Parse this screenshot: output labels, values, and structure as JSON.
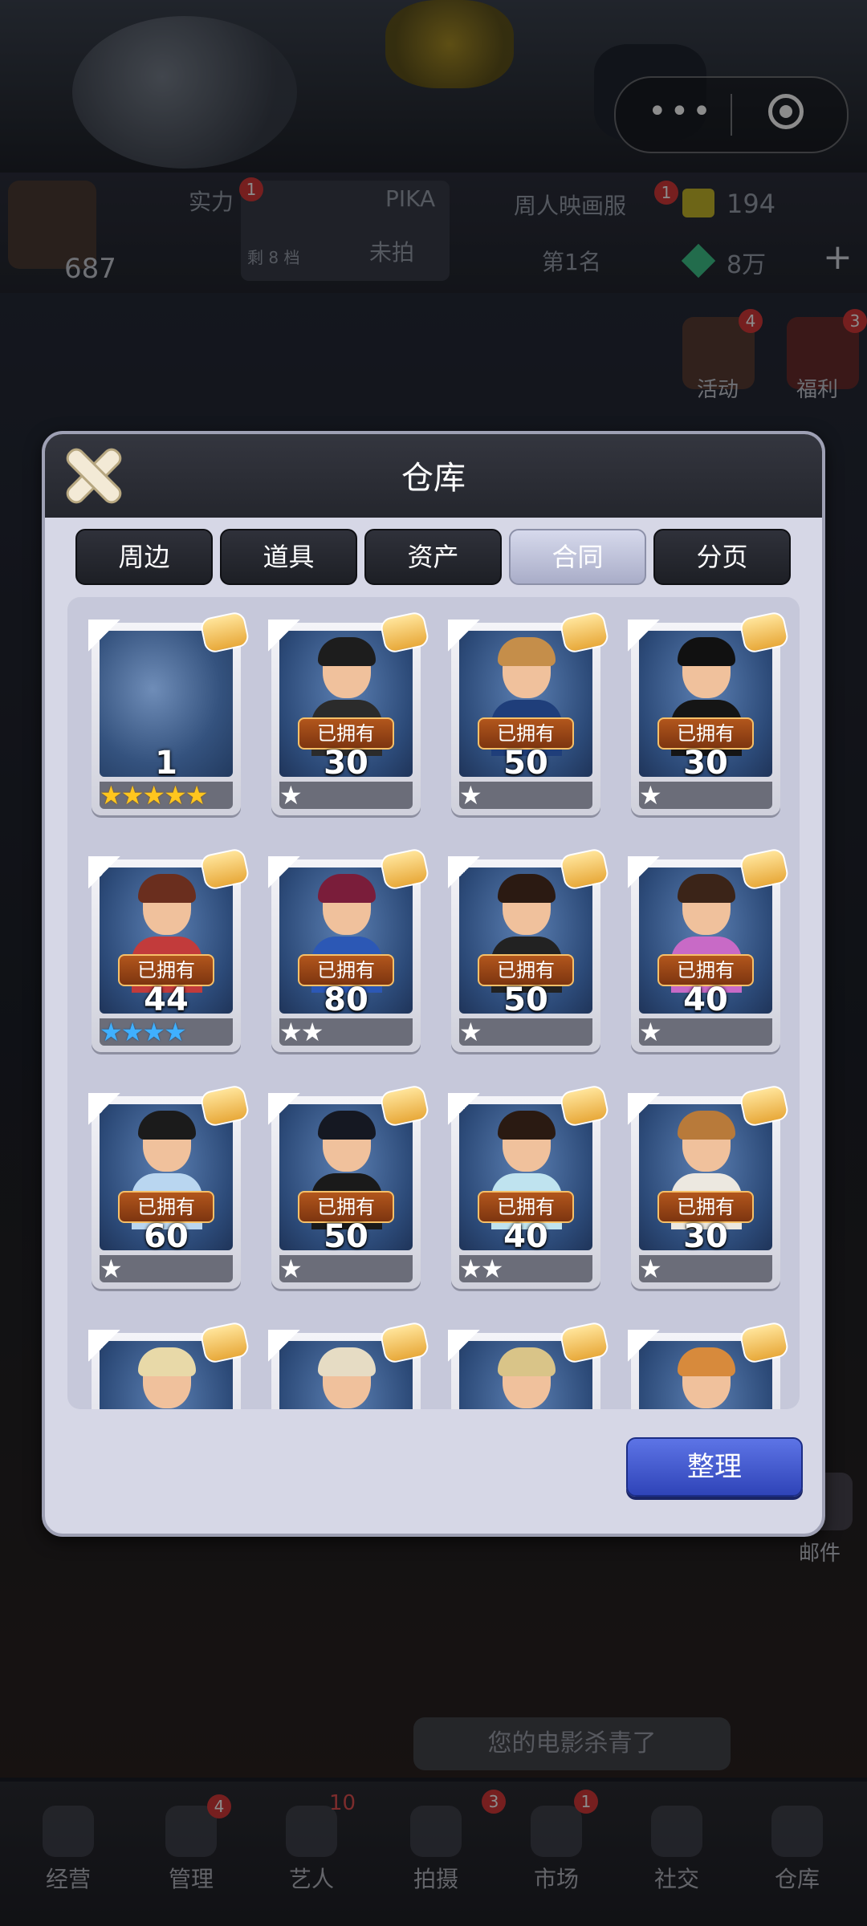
{
  "window": {
    "capsule": {
      "more_glyph": "•••",
      "close_glyph": "◎"
    }
  },
  "hud": {
    "player_score": "687",
    "strength_label": "实力",
    "film_title": "PIKA",
    "film_status": "未拍",
    "film_remaining": "剩 8 档",
    "ranking_title": "周人映画服",
    "ranking_value": "第1名",
    "coins": "194",
    "gems": "8万",
    "add_glyph": "+",
    "badges": {
      "film": "1",
      "ranking": "1",
      "player": "1"
    }
  },
  "side_menu": {
    "items": [
      {
        "label": "活动",
        "badge": "4"
      },
      {
        "label": "福利",
        "badge": "3"
      },
      {
        "label": "邮件",
        "badge": ""
      }
    ]
  },
  "background_message": "您的电影杀青了",
  "bottom_nav": {
    "items": [
      {
        "label": "经营",
        "badge": ""
      },
      {
        "label": "管理",
        "badge": "4"
      },
      {
        "label": "艺人",
        "badge": "10"
      },
      {
        "label": "拍摄",
        "badge": "3"
      },
      {
        "label": "市场",
        "badge": "1"
      },
      {
        "label": "社交",
        "badge": ""
      },
      {
        "label": "仓库",
        "badge": ""
      }
    ]
  },
  "modal": {
    "title": "仓库",
    "tabs": [
      {
        "label": "周边",
        "active": false
      },
      {
        "label": "道具",
        "active": false
      },
      {
        "label": "资产",
        "active": false
      },
      {
        "label": "合同",
        "active": true
      },
      {
        "label": "分页",
        "active": false
      }
    ],
    "owned_label": "已拥有",
    "cards": [
      {
        "count": "1",
        "owned": false,
        "stars": 5,
        "star_color": "gold",
        "hair": "#2a2a2a",
        "body": "#2d3b55",
        "blank": true
      },
      {
        "count": "30",
        "owned": true,
        "stars": 1,
        "star_color": "white",
        "hair": "#1d1d1d",
        "body": "#2b2b2b",
        "blank": false
      },
      {
        "count": "50",
        "owned": true,
        "stars": 1,
        "star_color": "white",
        "hair": "#c58e4a",
        "body": "#1f3e7a",
        "blank": false
      },
      {
        "count": "30",
        "owned": true,
        "stars": 1,
        "star_color": "white",
        "hair": "#111111",
        "body": "#151515",
        "blank": false
      },
      {
        "count": "44",
        "owned": true,
        "stars": 4,
        "star_color": "blue",
        "hair": "#6a2e1e",
        "body": "#c23b3b",
        "blank": false
      },
      {
        "count": "80",
        "owned": true,
        "stars": 2,
        "star_color": "white",
        "hair": "#7a1d3a",
        "body": "#2c58b5",
        "blank": false
      },
      {
        "count": "50",
        "owned": true,
        "stars": 1,
        "star_color": "white",
        "hair": "#2b1a12",
        "body": "#222222",
        "blank": false
      },
      {
        "count": "40",
        "owned": true,
        "stars": 1,
        "star_color": "white",
        "hair": "#3b2418",
        "body": "#c86ac6",
        "blank": false
      },
      {
        "count": "60",
        "owned": true,
        "stars": 1,
        "star_color": "white",
        "hair": "#1b1b1b",
        "body": "#b9d6f0",
        "blank": false
      },
      {
        "count": "50",
        "owned": true,
        "stars": 1,
        "star_color": "white",
        "hair": "#151822",
        "body": "#1a1a1a",
        "blank": false
      },
      {
        "count": "40",
        "owned": true,
        "stars": 2,
        "star_color": "white",
        "hair": "#2a1a12",
        "body": "#bfe3ef",
        "blank": false
      },
      {
        "count": "30",
        "owned": true,
        "stars": 1,
        "star_color": "white",
        "hair": "#b87a3a",
        "body": "#ece8e0",
        "blank": false
      },
      {
        "count": "",
        "owned": false,
        "stars": 0,
        "star_color": "white",
        "hair": "#e8d9a8",
        "body": "#dfe6f0",
        "blank": false
      },
      {
        "count": "",
        "owned": false,
        "stars": 0,
        "star_color": "white",
        "hair": "#e6dcc4",
        "body": "#7a5030",
        "blank": false
      },
      {
        "count": "",
        "owned": false,
        "stars": 0,
        "star_color": "white",
        "hair": "#d9c488",
        "body": "#e0b43a",
        "blank": false
      },
      {
        "count": "",
        "owned": false,
        "stars": 0,
        "star_color": "white",
        "hair": "#d78a3c",
        "body": "#f2d230",
        "blank": false
      }
    ],
    "sort_button": "整理"
  }
}
